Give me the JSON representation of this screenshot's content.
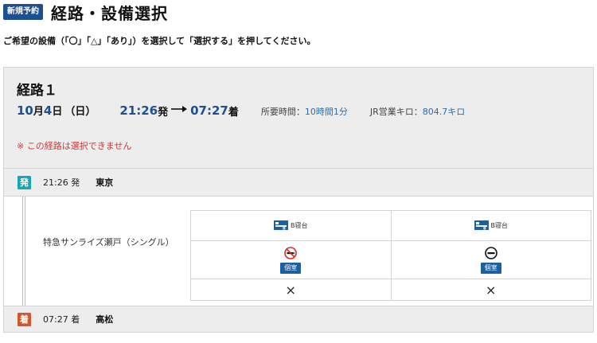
{
  "header": {
    "badge": "新規予約",
    "title": "経路・設備選択"
  },
  "instruction": "ご希望の設備（「〇」「△」「あり」）を選択して「選択する」を押してください。",
  "route": {
    "title": "経路１",
    "month": "10",
    "month_unit": "月",
    "day": "4",
    "day_unit": "日",
    "weekday": "（日）",
    "dep_time": "21:26",
    "dep_suffix": "発",
    "arr_time": "07:27",
    "arr_suffix": "着",
    "duration_label": "所要時間：",
    "duration_value": "10時間1分",
    "distance_label": "JR営業キロ：",
    "distance_value": "804.7キロ",
    "warning": "※ この経路は選択できません"
  },
  "departure": {
    "badge": "発",
    "time": "21:26 発",
    "station": "東京"
  },
  "arrival": {
    "badge": "着",
    "time": "07:27 着",
    "station": "高松"
  },
  "train": {
    "name": "特急サンライズ瀬戸（シングル）"
  },
  "facilities": [
    {
      "car_type": "B寝台",
      "room_type": "個室",
      "smoking_icon": "no-smoking-icon",
      "availability": "×"
    },
    {
      "car_type": "B寝台",
      "room_type": "個室",
      "smoking_icon": "no-entry-icon",
      "availability": "×"
    }
  ],
  "colors": {
    "brand_blue": "#1d4f91",
    "link_blue": "#2a6fb0",
    "warning_red": "#cc3b3b",
    "departure_teal": "#1aa5b4",
    "arrival_orange": "#d4572c"
  }
}
